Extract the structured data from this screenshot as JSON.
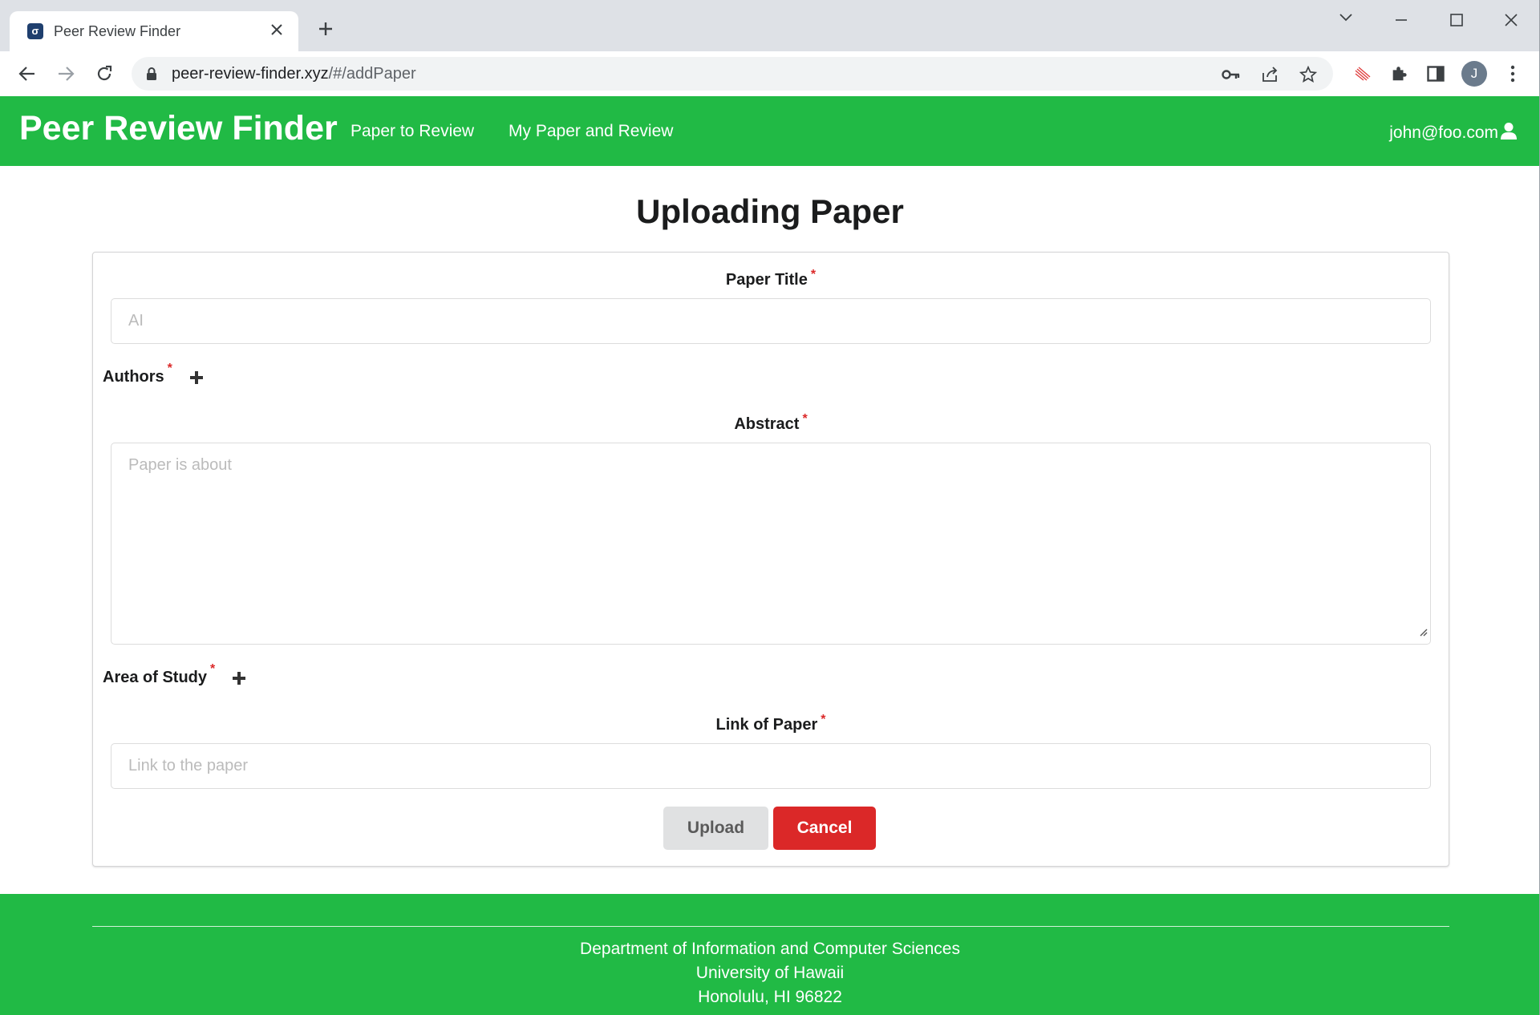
{
  "browser": {
    "tab_title": "Peer Review Finder",
    "favicon_letter": "σ",
    "url_host": "peer-review-finder.xyz",
    "url_path": "/#/addPaper",
    "profile_initial": "J"
  },
  "navbar": {
    "brand": "Peer Review Finder",
    "links": [
      "Paper to Review",
      "My Paper and Review"
    ],
    "user_email": "john@foo.com"
  },
  "form": {
    "heading": "Uploading Paper",
    "required_mark": "*",
    "title_label": "Paper Title",
    "title_placeholder": "AI",
    "authors_label": "Authors",
    "abstract_label": "Abstract",
    "abstract_placeholder": "Paper is about",
    "area_label": "Area of Study",
    "link_label": "Link of Paper",
    "link_placeholder": "Link to the paper",
    "upload_label": "Upload",
    "cancel_label": "Cancel"
  },
  "footer": {
    "lines": [
      "Department of Information and Computer Sciences",
      "University of Hawaii",
      "Honolulu, HI 96822"
    ]
  },
  "colors": {
    "brand_green": "#21ba45",
    "cancel_red": "#db2828",
    "upload_grey": "#e0e1e2",
    "required_red": "#db2828"
  },
  "icons": [
    "favicon-icon",
    "close-icon",
    "plus-icon",
    "chevron-down-icon",
    "minimize-icon",
    "maximize-icon",
    "window-close-icon",
    "back-icon",
    "forward-icon",
    "reload-icon",
    "lock-icon",
    "key-icon",
    "share-icon",
    "star-icon",
    "extension-red-icon",
    "puzzle-icon",
    "sidepanel-icon",
    "kebab-menu-icon",
    "user-icon",
    "add-author-icon",
    "add-area-icon",
    "resize-grip-icon"
  ]
}
